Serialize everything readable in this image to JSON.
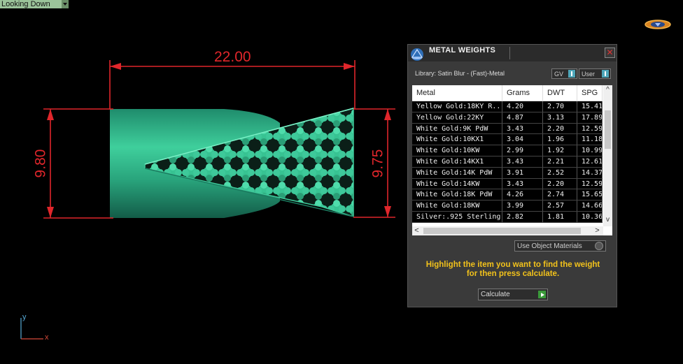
{
  "viewport": {
    "view_label": "Looking Down"
  },
  "dimensions": {
    "width": "22.00",
    "height_left": "9.80",
    "height_right": "9.75"
  },
  "axis": {
    "y": "y",
    "x": "x"
  },
  "panel": {
    "title": "METAL WEIGHTS",
    "library": "Library: Satin Blur - (Fast)-Metal",
    "gv_label": "GV",
    "user_label": "User",
    "columns": [
      "Metal",
      "Grams",
      "DWT",
      "SPG"
    ],
    "rows": [
      [
        "Yellow Gold:18KY R...",
        "4.20",
        "2.70",
        "15.41"
      ],
      [
        "Yellow Gold:22KY",
        "4.87",
        "3.13",
        "17.89"
      ],
      [
        "White Gold:9K PdW",
        "3.43",
        "2.20",
        "12.59"
      ],
      [
        "White Gold:10KX1",
        "3.04",
        "1.96",
        "11.18"
      ],
      [
        "White Gold:10KW",
        "2.99",
        "1.92",
        "10.99"
      ],
      [
        "White Gold:14KX1",
        "3.43",
        "2.21",
        "12.61"
      ],
      [
        "White Gold:14K PdW",
        "3.91",
        "2.52",
        "14.37"
      ],
      [
        "White Gold:14KW",
        "3.43",
        "2.20",
        "12.59"
      ],
      [
        "White Gold:18K PdW",
        "4.26",
        "2.74",
        "15.65"
      ],
      [
        "White Gold:18KW",
        "3.99",
        "2.57",
        "14.66"
      ],
      [
        "Silver:.925 Sterling",
        "2.82",
        "1.81",
        "10.36"
      ]
    ],
    "use_object_materials": "Use Object Materials",
    "hint_line1": "Highlight the item you want to find the weight",
    "hint_line2": "for then press calculate.",
    "calculate_label": "Calculate"
  },
  "colors": {
    "accent": "#f2c21b",
    "dimension": "#e0262b",
    "metal": "#2fb08a"
  }
}
